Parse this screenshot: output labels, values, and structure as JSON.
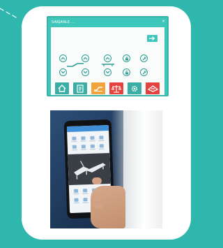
{
  "panel": {
    "title": "SARJANLE ...",
    "close": "×"
  },
  "icons": {
    "arrow": "right-arrow-icon",
    "controls": [
      "chevron-up-icon",
      "chevron-down-icon",
      "lock-icon",
      "wrench-icon"
    ],
    "toolbar": [
      "home-icon",
      "document-icon",
      "bed-position-icon",
      "scale-icon",
      "settings-icon",
      "bed-alert-icon"
    ]
  },
  "colors": {
    "background": "#2fb7ad",
    "panel": "#3ec6bb",
    "toolbar_green": "#3aaea4",
    "toolbar_orange": "#f2a33a",
    "toolbar_red": "#e5413e"
  }
}
